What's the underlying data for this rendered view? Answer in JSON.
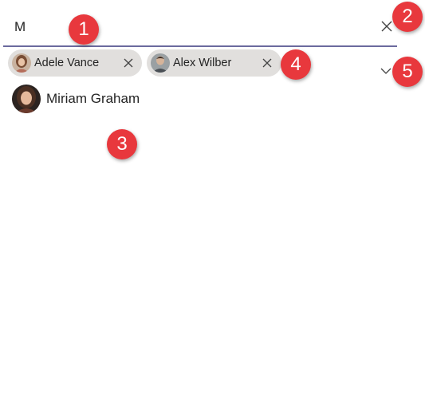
{
  "search": {
    "value": "M",
    "placeholder": ""
  },
  "icons": {
    "clear": "close-icon",
    "chip_remove": "close-icon",
    "expand": "chevron-down-icon"
  },
  "selected_people": [
    {
      "name": "Adele Vance"
    },
    {
      "name": "Alex Wilber"
    }
  ],
  "suggestions": [
    {
      "name": "Miriam Graham"
    }
  ],
  "callouts": [
    "1",
    "2",
    "3",
    "4",
    "5"
  ],
  "colors": {
    "underline": "#6b6a9e",
    "chip_bg": "#e1dfdd",
    "callout": "#e8383d",
    "text": "#242424"
  }
}
